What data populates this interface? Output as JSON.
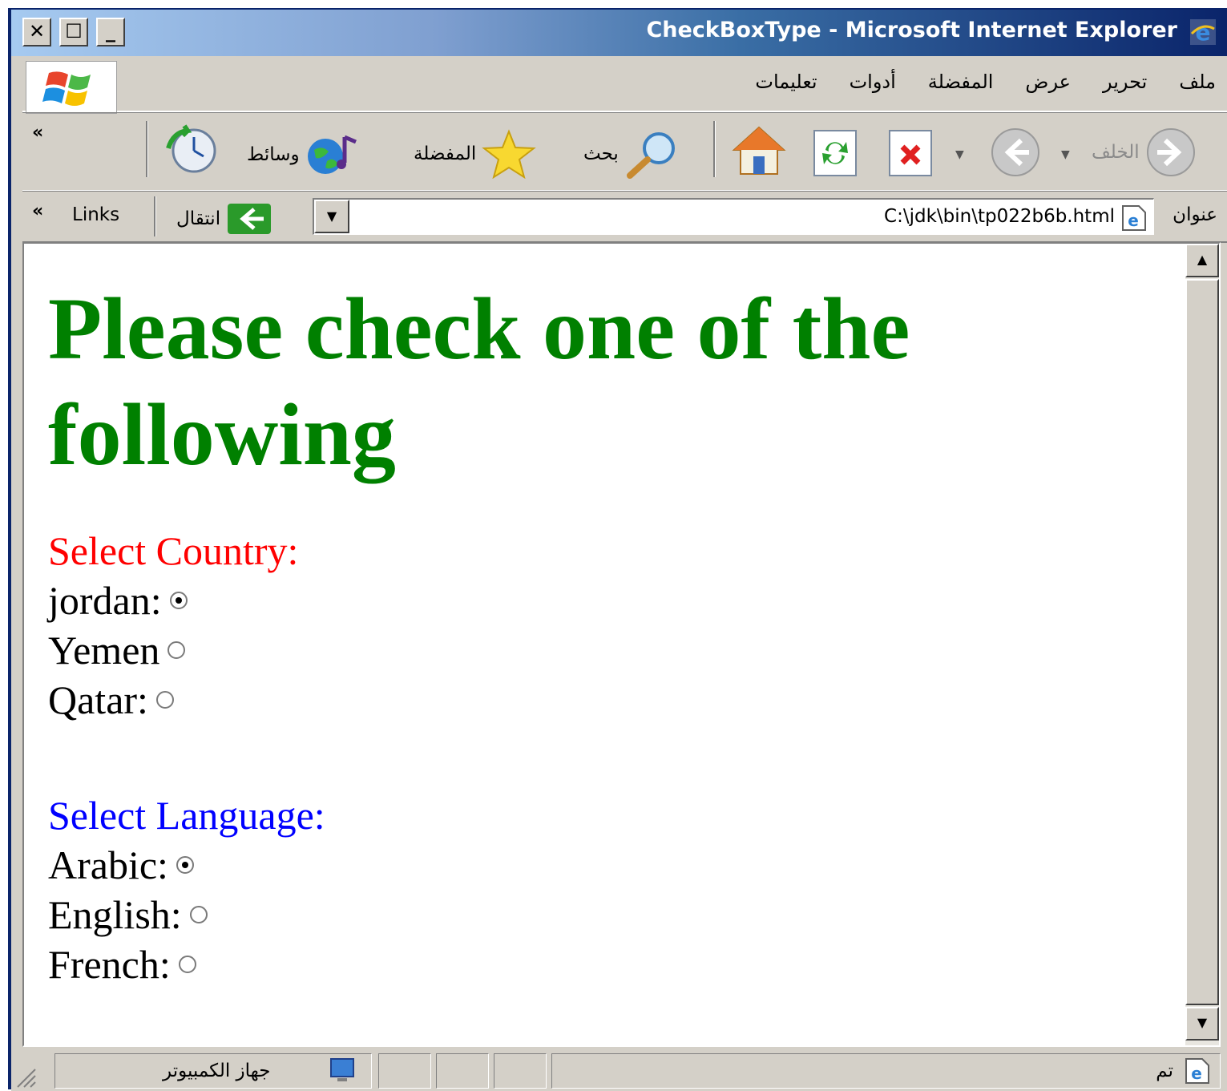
{
  "window": {
    "title": "CheckBoxType - Microsoft Internet Explorer"
  },
  "menu": [
    "ملف",
    "تحرير",
    "عرض",
    "المفضلة",
    "أدوات",
    "تعليمات"
  ],
  "toolbar": {
    "back_label": "الخلف",
    "search_label": "بحث",
    "favorites_label": "المفضلة",
    "media_label": "وسائط"
  },
  "address": {
    "label": "عنوان",
    "value": "C:\\jdk\\bin\\tp022b6b.html",
    "go_label": "انتقال",
    "links_label": "Links"
  },
  "page": {
    "heading": "Please check one of the following",
    "country_label": "Select Country:",
    "country_options": [
      {
        "label": "jordan:",
        "checked": true
      },
      {
        "label": "Yemen",
        "checked": false
      },
      {
        "label": "Qatar:",
        "checked": false
      }
    ],
    "language_label": "Select Language:",
    "language_options": [
      {
        "label": "Arabic:",
        "checked": true
      },
      {
        "label": "English:",
        "checked": false
      },
      {
        "label": "French:",
        "checked": false
      }
    ],
    "colors": {
      "heading": "#008000",
      "country_label": "#ff0000",
      "language_label": "#0000ff"
    }
  },
  "status": {
    "done_text": "تم",
    "zone_text": "جهاز الكمبيوتر"
  }
}
